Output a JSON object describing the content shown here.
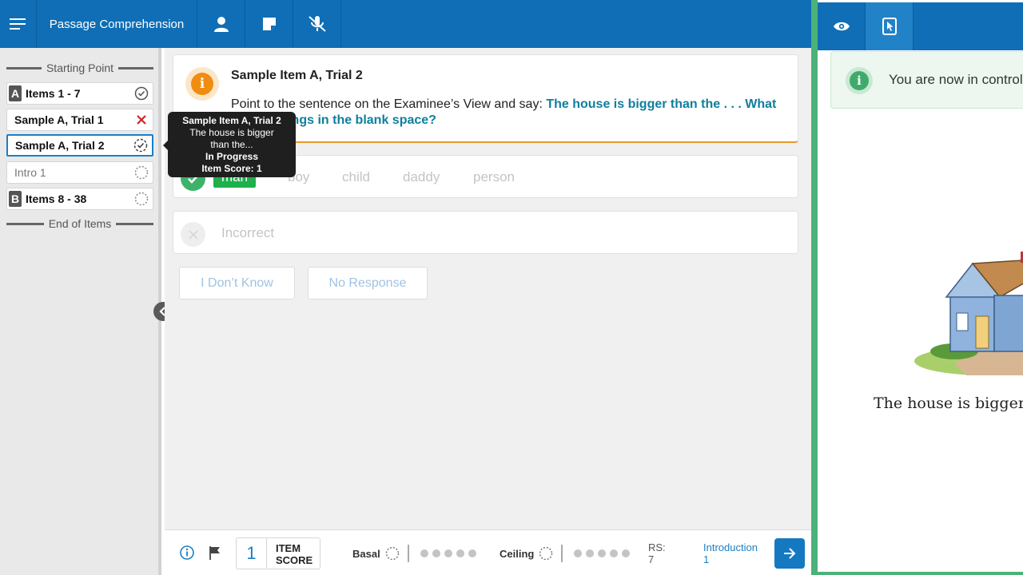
{
  "header": {
    "title": "Passage Comprehension",
    "icons": [
      "menu-icon",
      "person-icon",
      "note-icon",
      "mic-off-icon"
    ]
  },
  "sidebar": {
    "starting_point": "Starting Point",
    "end_label": "End of Items",
    "items": [
      {
        "letter": "A",
        "label": "Items 1 - 7",
        "status": "complete"
      },
      {
        "label": "Sample A, Trial 1",
        "status": "incorrect"
      },
      {
        "label": "Sample A, Trial 2",
        "status": "in-progress",
        "active": true
      },
      {
        "label": "Intro 1",
        "status": "not-started"
      },
      {
        "letter": "B",
        "label": "Items 8 - 38",
        "status": "not-started"
      }
    ]
  },
  "tooltip": {
    "title": "Sample Item A, Trial 2",
    "line1": "The house is bigger",
    "line2": "than the...",
    "status": "In Progress",
    "score": "Item Score: 1"
  },
  "item": {
    "title": "Sample Item A, Trial 2",
    "instruction": "Point to the sentence on the Examinee’s View and say: ",
    "prompt": "The house is bigger than the . . . What word belongs in the blank space?"
  },
  "responses": {
    "correct": [
      "man",
      "boy",
      "child",
      "daddy",
      "person"
    ],
    "selected": "man",
    "incorrect_label": "Incorrect"
  },
  "buttons": {
    "dont_know": "I Don’t Know",
    "no_response": "No Response"
  },
  "footer": {
    "item_score_value": "1",
    "item_score_label_1": "ITEM",
    "item_score_label_2": "SCORE",
    "basal_label": "Basal",
    "ceiling_label": "Ceiling",
    "rs_label": "RS:",
    "rs_value": "7",
    "section_label": "Introduction",
    "section_value": "1"
  },
  "examinee_view": {
    "notice": "You are now in control",
    "sentence": "The house is bigger than the"
  },
  "colors": {
    "brand_blue": "#0f6eb5",
    "prompt_teal": "#0f7f9c",
    "correct_green": "#1eb04c",
    "panel_border_green": "#4bb27a",
    "info_orange": "#f08c10"
  }
}
